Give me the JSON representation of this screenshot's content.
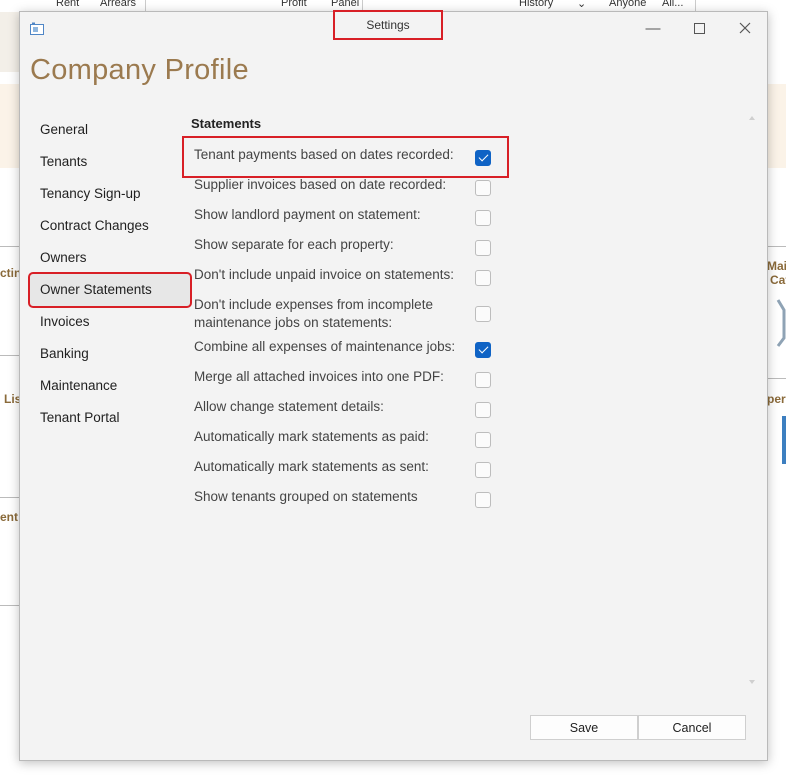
{
  "background": {
    "top_labels": [
      "Rent",
      "Arrears",
      "Profit",
      "Panel",
      "History",
      "Anyone",
      "All..."
    ],
    "left_labels": [
      "ctin",
      "Lis",
      "ent"
    ],
    "right_labels": [
      "Mai",
      "Cat",
      "per"
    ]
  },
  "dialog": {
    "title": "Settings",
    "page_title": "Company Profile"
  },
  "nav": {
    "items": [
      {
        "label": "General"
      },
      {
        "label": "Tenants"
      },
      {
        "label": "Tenancy Sign-up"
      },
      {
        "label": "Contract Changes"
      },
      {
        "label": "Owners"
      },
      {
        "label": "Owner Statements"
      },
      {
        "label": "Invoices"
      },
      {
        "label": "Banking"
      },
      {
        "label": "Maintenance"
      },
      {
        "label": "Tenant Portal"
      }
    ],
    "selected": "Owner Statements"
  },
  "statements": {
    "section_title": "Statements",
    "options": [
      {
        "label": "Tenant payments based on dates recorded:",
        "checked": true
      },
      {
        "label": "Supplier invoices based on date recorded:",
        "checked": false
      },
      {
        "label": "Show landlord payment on statement:",
        "checked": false
      },
      {
        "label": "Show separate for each property:",
        "checked": false
      },
      {
        "label": "Don't include unpaid invoice on statements:",
        "checked": false
      },
      {
        "label": "Don't include expenses from incomplete maintenance jobs on statements:",
        "checked": false
      },
      {
        "label": "Combine all expenses of maintenance jobs:",
        "checked": true
      },
      {
        "label": "Merge all attached invoices into one PDF:",
        "checked": false
      },
      {
        "label": "Allow change statement details:",
        "checked": false
      },
      {
        "label": "Automatically mark statements as paid:",
        "checked": false
      },
      {
        "label": "Automatically mark statements as sent:",
        "checked": false
      },
      {
        "label": "Show tenants grouped on statements",
        "checked": false
      }
    ]
  },
  "footer": {
    "save_label": "Save",
    "cancel_label": "Cancel"
  },
  "colors": {
    "accent_title": "#9b7a4f",
    "highlight_red": "#d81f26",
    "checkbox_blue": "#0f63c5"
  }
}
